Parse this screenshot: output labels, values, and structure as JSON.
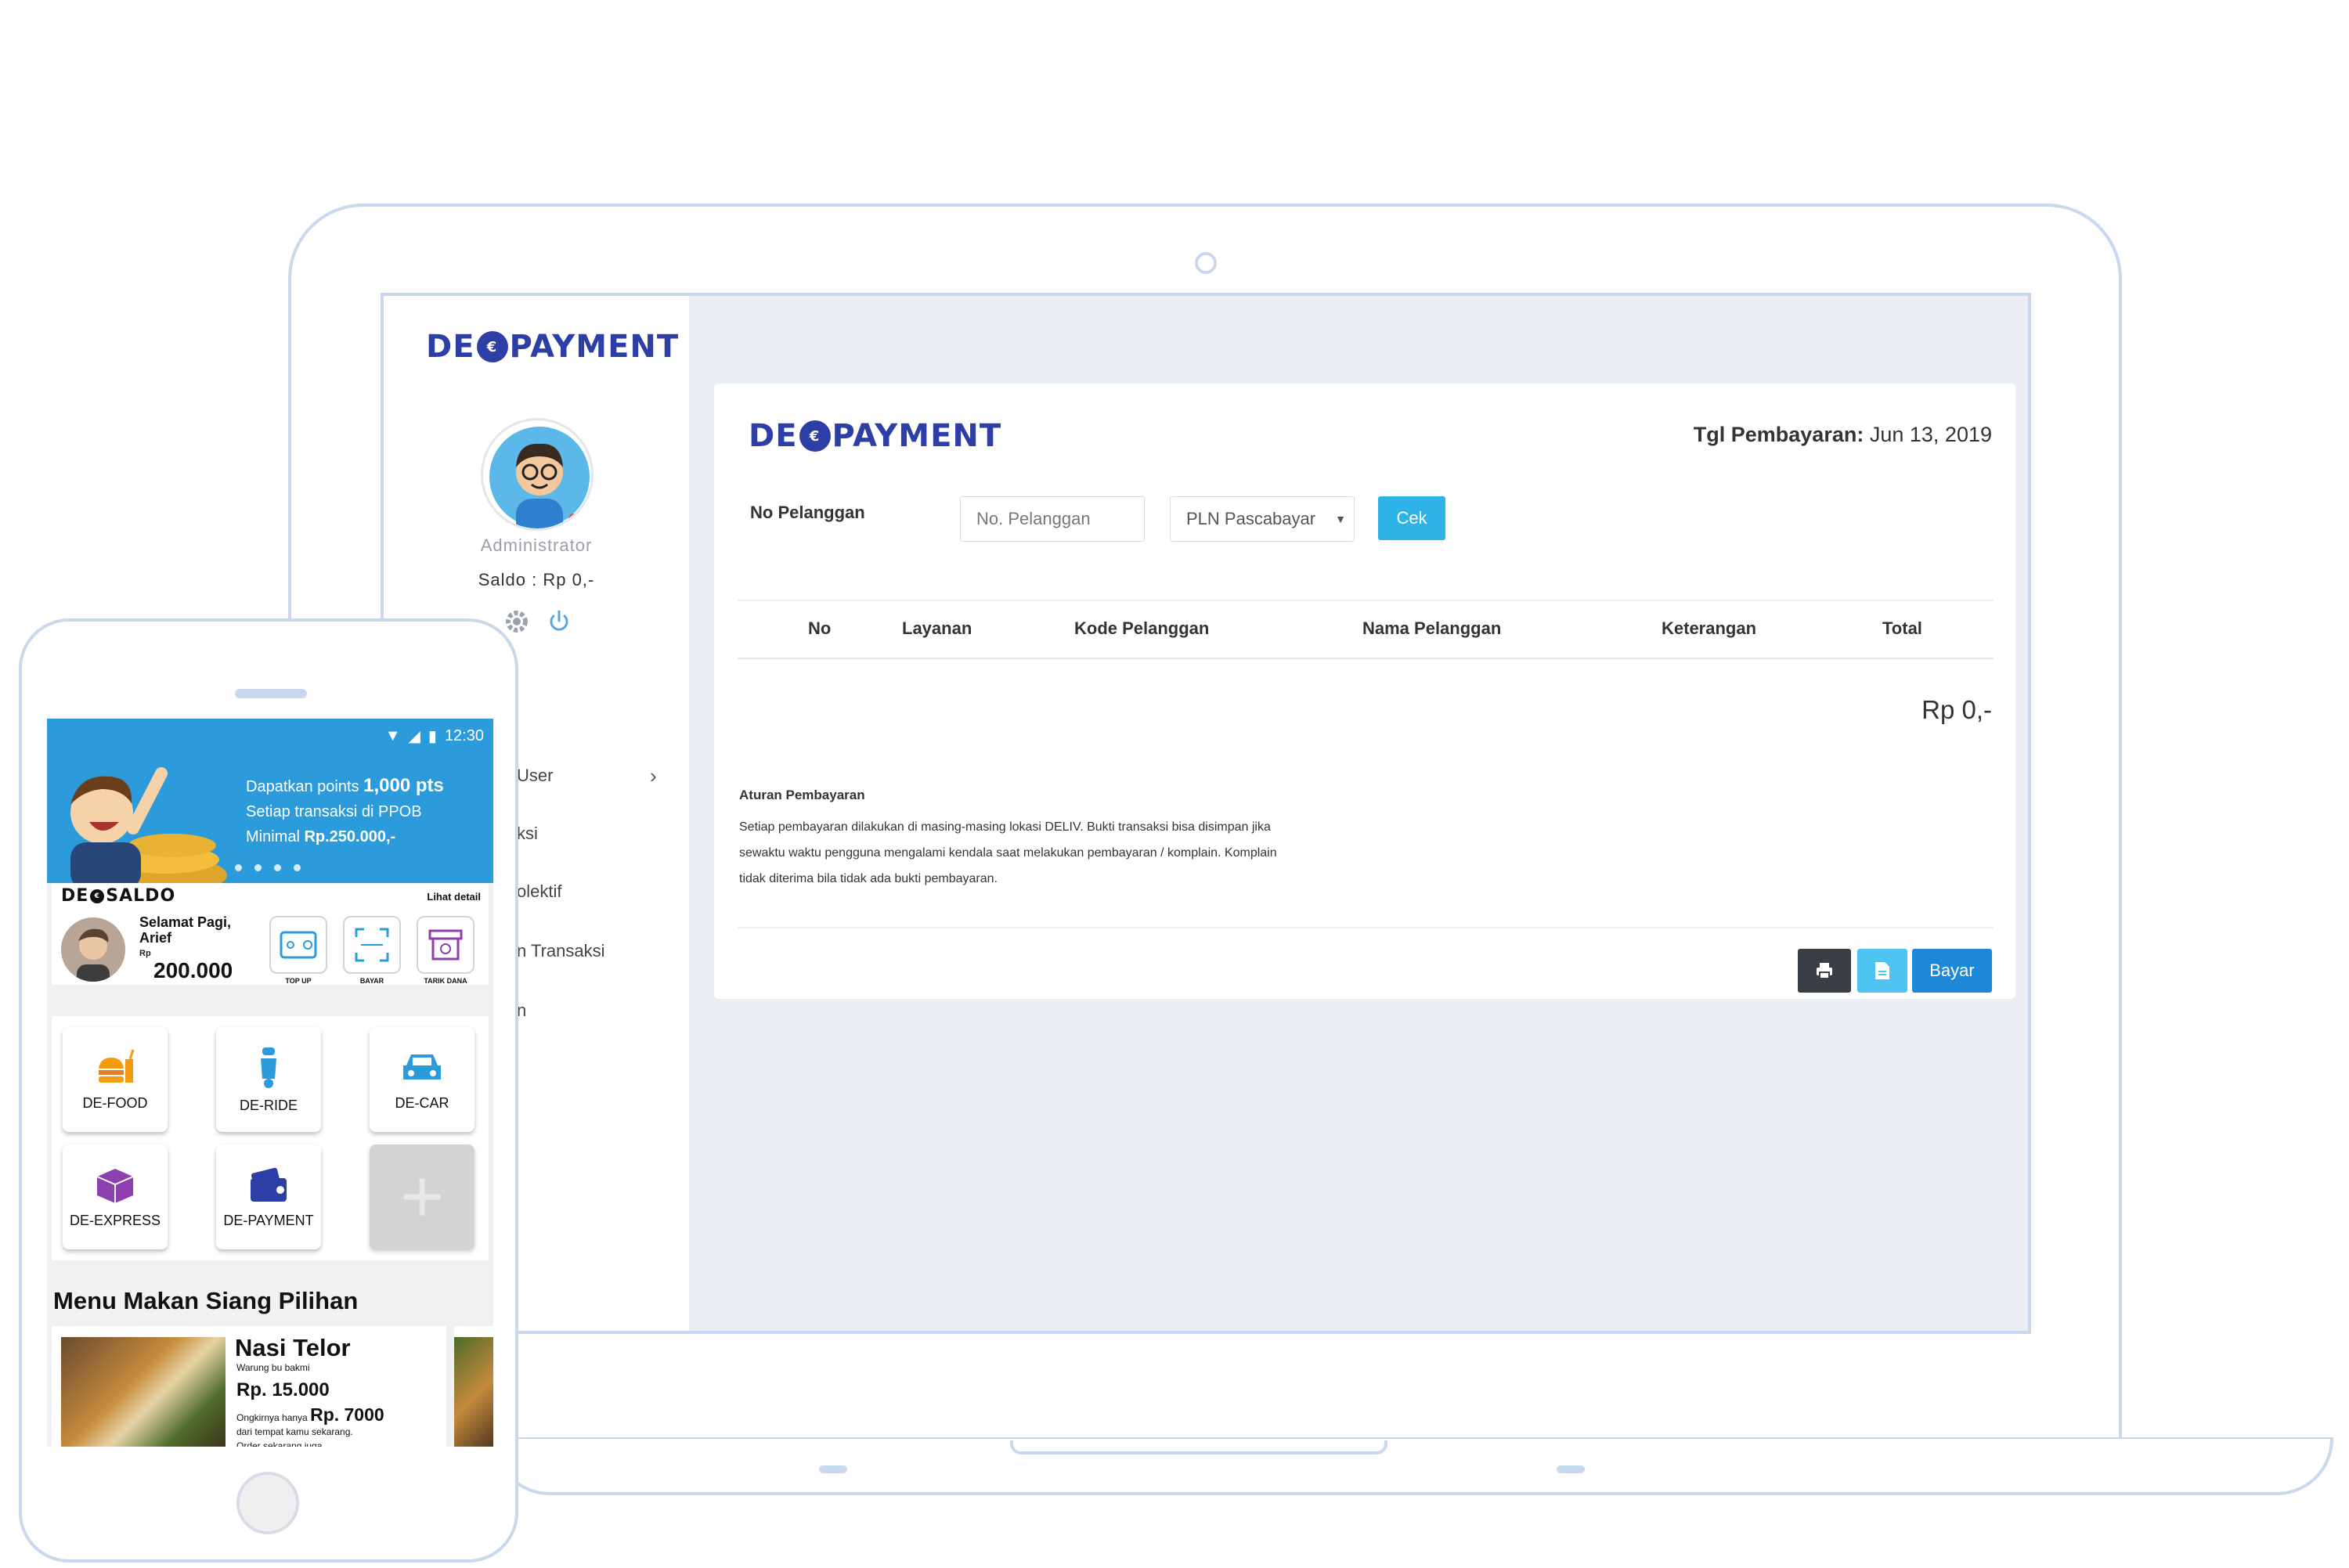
{
  "brand": {
    "logo_prefix": "DE",
    "logo_suffix": "PAYMENT",
    "accent": "#2d3fa6"
  },
  "sidebar": {
    "role": "Administrator",
    "saldo": "Saldo : Rp 0,-",
    "menu": [
      "User",
      "ksi",
      "olektif",
      "n Transaksi",
      "n"
    ]
  },
  "main": {
    "date_label": "Tgl Pembayaran:",
    "date_value": "Jun 13, 2019",
    "customer_label": "No Pelanggan",
    "customer_placeholder": "No. Pelanggan",
    "service_selected": "PLN Pascabayar",
    "check_button": "Cek",
    "table_headers": [
      "No",
      "Layanan",
      "Kode Pelanggan",
      "Nama Pelanggan",
      "Keterangan",
      "Total"
    ],
    "total": "Rp 0,-",
    "rules_title": "Aturan Pembayaran",
    "rules_lines": [
      "Setiap pembayaran dilakukan di masing-masing lokasi DELIV. Bukti transaksi bisa disimpan jika",
      "sewaktu waktu pengguna mengalami kendala saat melakukan pembayaran / komplain. Komplain",
      "tidak diterima bila tidak ada bukti pembayaran."
    ],
    "pay_button": "Bayar",
    "colors": {
      "cek": "#2eb3e6",
      "print": "#3a3f45",
      "pdf": "#4fc3ef",
      "pay": "#1e88d8"
    }
  },
  "phone": {
    "status_time": "12:30",
    "banner_line1_prefix": "Dapatkan points",
    "banner_line1_value": "1,000 pts",
    "banner_line2": "Setiap transaksi di PPOB",
    "banner_line3_prefix": "Minimal",
    "banner_line3_value": "Rp.250.000,-",
    "saldo_logo_prefix": "DE",
    "saldo_logo_suffix": "SALDO",
    "detail_link": "Lihat detail",
    "greeting_line1": "Selamat Pagi,",
    "greeting_line2": "Arief",
    "currency": "Rp",
    "balance": "200.000",
    "quick_actions": [
      "TOP UP",
      "BAYAR",
      "TARIK DANA"
    ],
    "services": [
      "DE-FOOD",
      "DE-RIDE",
      "DE-CAR",
      "DE-EXPRESS",
      "DE-PAYMENT"
    ],
    "menu_title": "Menu Makan Siang Pilihan",
    "food": {
      "name": "Nasi Telor",
      "vendor": "Warung bu bakmi",
      "price": "Rp. 15.000",
      "ongkir_prefix": "Ongkirnya hanya",
      "ongkir_value": "Rp. 7000",
      "note_line1": "dari tempat kamu sekarang.",
      "note_line2": "Order sekarang juga."
    }
  }
}
